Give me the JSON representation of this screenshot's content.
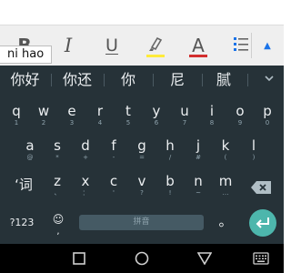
{
  "toolbar": {
    "bold_label": "B",
    "italic_label": "I",
    "underline_label": "U",
    "text_color_label": "A",
    "highlight_color": "#ffeb3b",
    "text_color": "#d32f2f"
  },
  "composing_tooltip": "ni hao",
  "candidates": [
    "你好",
    "你还",
    "你",
    "尼",
    "腻"
  ],
  "keyboard": {
    "row1": [
      {
        "key": "q",
        "hint": "1"
      },
      {
        "key": "w",
        "hint": "2"
      },
      {
        "key": "e",
        "hint": "3"
      },
      {
        "key": "r",
        "hint": "4"
      },
      {
        "key": "t",
        "hint": "5"
      },
      {
        "key": "y",
        "hint": "6"
      },
      {
        "key": "u",
        "hint": "7"
      },
      {
        "key": "i",
        "hint": "8"
      },
      {
        "key": "o",
        "hint": "9"
      },
      {
        "key": "p",
        "hint": "0"
      }
    ],
    "row2": [
      {
        "key": "a",
        "hint": "@"
      },
      {
        "key": "s",
        "hint": "*"
      },
      {
        "key": "d",
        "hint": "+"
      },
      {
        "key": "f",
        "hint": "-"
      },
      {
        "key": "g",
        "hint": "="
      },
      {
        "key": "h",
        "hint": "/"
      },
      {
        "key": "j",
        "hint": "#"
      },
      {
        "key": "k",
        "hint": "("
      },
      {
        "key": "l",
        "hint": ")"
      }
    ],
    "row3": [
      {
        "key": "z",
        "hint": "、"
      },
      {
        "key": "x",
        "hint": "："
      },
      {
        "key": "c",
        "hint": "'"
      },
      {
        "key": "v",
        "hint": "?"
      },
      {
        "key": "b",
        "hint": "!"
      },
      {
        "key": "n",
        "hint": "~"
      },
      {
        "key": "m",
        "hint": "…"
      }
    ],
    "ci_key": "‘词",
    "symbols_key": "?123",
    "emoji_comma_hint": ",",
    "space_label": "拼音",
    "period_key": "。"
  },
  "colors": {
    "keyboard_bg": "#263238",
    "enter_accent": "#4db6ac",
    "toolbar_bg": "#efefef"
  }
}
